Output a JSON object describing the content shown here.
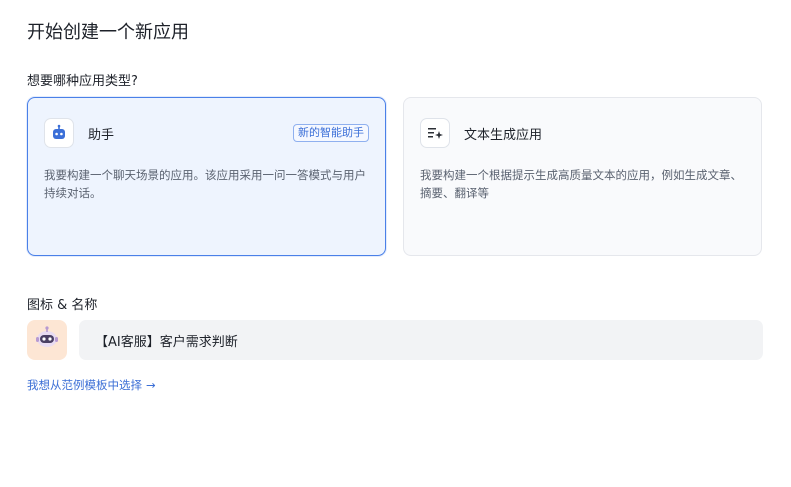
{
  "dialog": {
    "title": "开始创建一个新应用"
  },
  "type_section": {
    "label": "想要哪种应用类型?"
  },
  "cards": {
    "assistant": {
      "icon": "robot-icon",
      "name": "助手",
      "badge": "新的智能助手",
      "description": "我要构建一个聊天场景的应用。该应用采用一问一答模式与用户持续对话。",
      "selected": true
    },
    "text_generation": {
      "icon": "text-sparkle-icon",
      "name": "文本生成应用",
      "description": "我要构建一个根据提示生成高质量文本的应用，例如生成文章、摘要、翻译等",
      "selected": false
    }
  },
  "icon_section": {
    "label": "图标 & 名称"
  },
  "app": {
    "avatar_icon": "robot-avatar-icon",
    "name_value": "【AI客服】客户需求判断"
  },
  "template_link": {
    "label": "我想从范例模板中选择",
    "arrow": "→"
  },
  "colors": {
    "accent": "#4a80e8",
    "link": "#3c6fd6",
    "avatar_bg": "#fde6d4"
  }
}
